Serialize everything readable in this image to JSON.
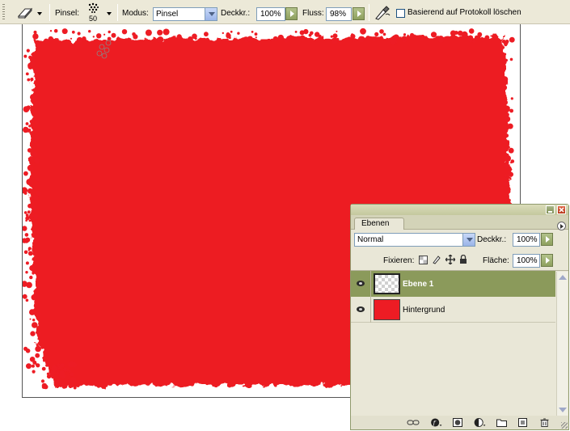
{
  "options_bar": {
    "tool_icon": "eraser-icon",
    "brush_label": "Pinsel:",
    "brush_size": "50",
    "mode_label": "Modus:",
    "mode_value": "Pinsel",
    "opacity_label": "Deckkr.:",
    "opacity_value": "100%",
    "flow_label": "Fluss:",
    "flow_value": "98%",
    "airbrush_icon": "airbrush-icon",
    "erase_to_history_label": "Basierend auf Protokoll löschen",
    "erase_to_history_checked": false
  },
  "canvas": {
    "fill_color": "#ed1c24",
    "background_color": "#ffffff"
  },
  "layers_panel": {
    "tab_label": "Ebenen",
    "blend_mode": "Normal",
    "opacity_label": "Deckkr.:",
    "opacity_value": "100%",
    "lock_label": "Fixieren:",
    "fill_label": "Fläche:",
    "fill_value": "100%",
    "selected_row_color": "#8b9a5b",
    "layers": [
      {
        "name": "Ebene 1",
        "selected": true,
        "thumbnail": "transparent"
      },
      {
        "name": "Hintergrund",
        "selected": false,
        "thumbnail": "red"
      }
    ]
  }
}
